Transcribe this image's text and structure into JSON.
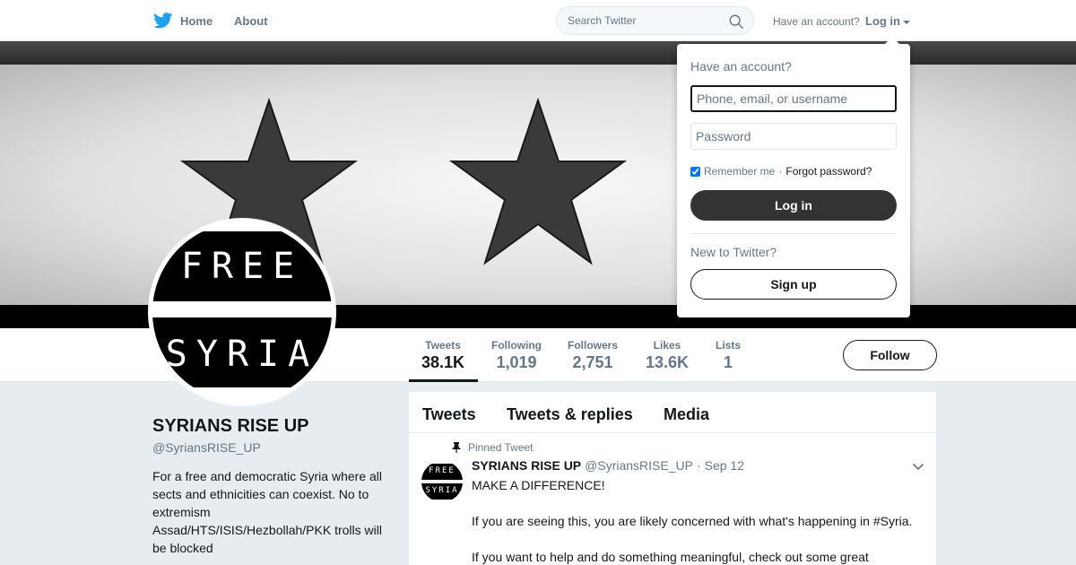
{
  "colors": {
    "twitter_blue": "#1da1f2",
    "text_dark": "#14171a",
    "text_gray": "#657786",
    "page_bg": "#e6ecf0",
    "login_button_bg": "#333333"
  },
  "topbar": {
    "logo_icon": "twitter-bird-icon",
    "home_label": "Home",
    "about_label": "About",
    "search_placeholder": "Search Twitter",
    "search_icon": "magnifier-icon",
    "have_account": "Have an account?",
    "login_label": "Log in"
  },
  "login_dropdown": {
    "title": "Have an account?",
    "username_placeholder": "Phone, email, or username",
    "password_placeholder": "Password",
    "remember_label": "Remember me",
    "remember_checked": true,
    "separator": "·",
    "forgot_label": "Forgot password?",
    "login_button": "Log in",
    "new_label": "New to Twitter?",
    "signup_button": "Sign up"
  },
  "banner": {
    "star_count": 2
  },
  "avatar": {
    "line1": "FREE",
    "line2": "SYRIA"
  },
  "stats": [
    {
      "label": "Tweets",
      "value": "38.1K",
      "active": true
    },
    {
      "label": "Following",
      "value": "1,019"
    },
    {
      "label": "Followers",
      "value": "2,751"
    },
    {
      "label": "Likes",
      "value": "13.6K"
    },
    {
      "label": "Lists",
      "value": "1"
    }
  ],
  "follow_button": "Follow",
  "profile": {
    "name": "SYRIANS RISE UP",
    "handle": "@SyriansRISE_UP",
    "bio": "For a free and democratic Syria where all sects and ethnicities can coexist. No to extremism Assad/HTS/ISIS/Hezbollah/PKK trolls will be blocked"
  },
  "timeline": {
    "tabs": [
      "Tweets",
      "Tweets & replies",
      "Media"
    ],
    "pinned_label": "Pinned Tweet",
    "pin_icon": "pin-icon",
    "tweet": {
      "name": "SYRIANS RISE UP",
      "handle": "@SyriansRISE_UP",
      "dot": "·",
      "date": "Sep 12",
      "chevron_icon": "chevron-down-icon",
      "paragraphs": [
        "MAKE A DIFFERENCE!",
        "If you are seeing this, you are likely concerned with what's happening in #Syria.",
        "If you want to help and do something meaningful, check out some great"
      ]
    }
  }
}
